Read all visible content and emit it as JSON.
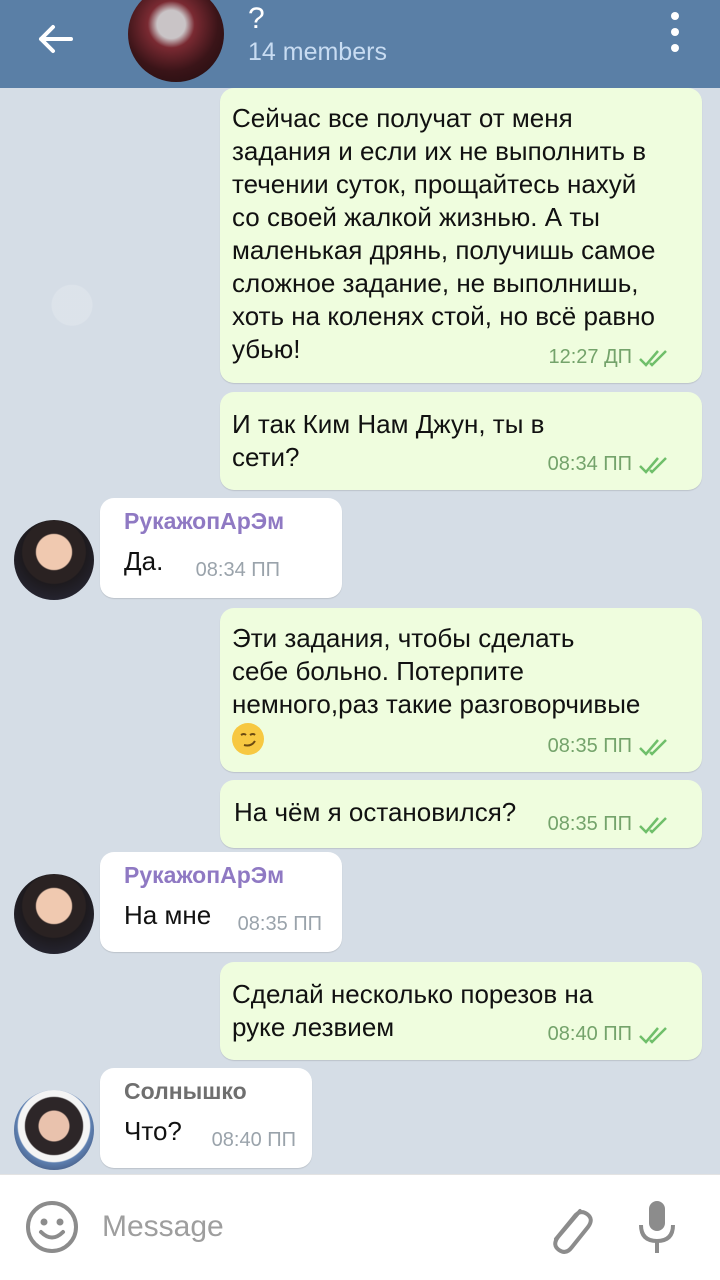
{
  "header": {
    "title": "?",
    "subtitle": "14 members"
  },
  "messages": [
    {
      "text": "Сейчас все получат от меня\nзадания и если их не выполнить в\nтечении суток, прощайтесь нахуй\nсо своей жалкой жизнью. А ты\nмаленькая дрянь, получишь самое\nсложное задание, не выполнишь,\nхоть на коленях стой, но всё равно\nубью!",
      "time": "12:27 ДП"
    },
    {
      "text": "И так Ким Нам Джун, ты в\nсети?",
      "time": "08:34 ПП"
    },
    {
      "sender": "РукажопАрЭм",
      "text": "Да.",
      "time": "08:34 ПП"
    },
    {
      "text": "Эти задания, чтобы сделать\nсебе больно. Потерпите\nнемного,раз такие разговорчивые",
      "time": "08:35 ПП"
    },
    {
      "text": "На чём я остановился?",
      "time": "08:35 ПП"
    },
    {
      "sender": "РукажопАрЭм",
      "text": "На мне",
      "time": "08:35 ПП"
    },
    {
      "text": "Сделай несколько порезов на\nруке лезвием",
      "time": "08:40 ПП"
    },
    {
      "sender": "Солнышко",
      "text": "Что?",
      "time": "08:40 ПП"
    }
  ],
  "input": {
    "placeholder": "Message"
  },
  "colors": {
    "header": "#5a7fa6",
    "outgoing_bubble": "#effdde",
    "incoming_bubble": "#ffffff",
    "check": "#6fbf6a",
    "sender_purple": "#8f79c3"
  },
  "icons": [
    "back-arrow-icon",
    "more-vertical-icon",
    "emoji-icon",
    "attach-icon",
    "mic-icon",
    "double-check-icon",
    "smirk-emoji-icon"
  ]
}
